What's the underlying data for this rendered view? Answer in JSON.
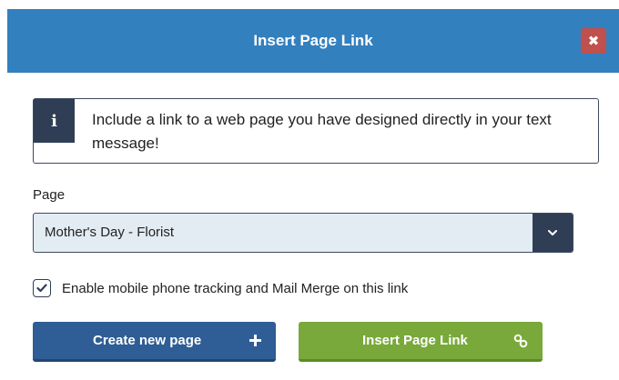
{
  "dialog": {
    "title": "Insert Page Link",
    "close_icon": "close-icon"
  },
  "info": {
    "icon": "info-icon",
    "message": "Include a link to a web page you have designed directly in your text message!"
  },
  "page_field": {
    "label": "Page",
    "selected": "Mother's Day - Florist",
    "arrow_icon": "chevron-down-icon"
  },
  "tracking": {
    "checked": true,
    "label": "Enable mobile phone tracking and Mail Merge on this link"
  },
  "buttons": {
    "create_label": "Create new page",
    "create_icon": "plus-icon",
    "insert_label": "Insert Page Link",
    "insert_icon": "link-icon"
  },
  "colors": {
    "header": "#3380bf",
    "close": "#c0504d",
    "dark": "#2f3e55",
    "create_button": "#2f5d95",
    "insert_button": "#79a93a",
    "select_bg": "#e3ecf3"
  }
}
